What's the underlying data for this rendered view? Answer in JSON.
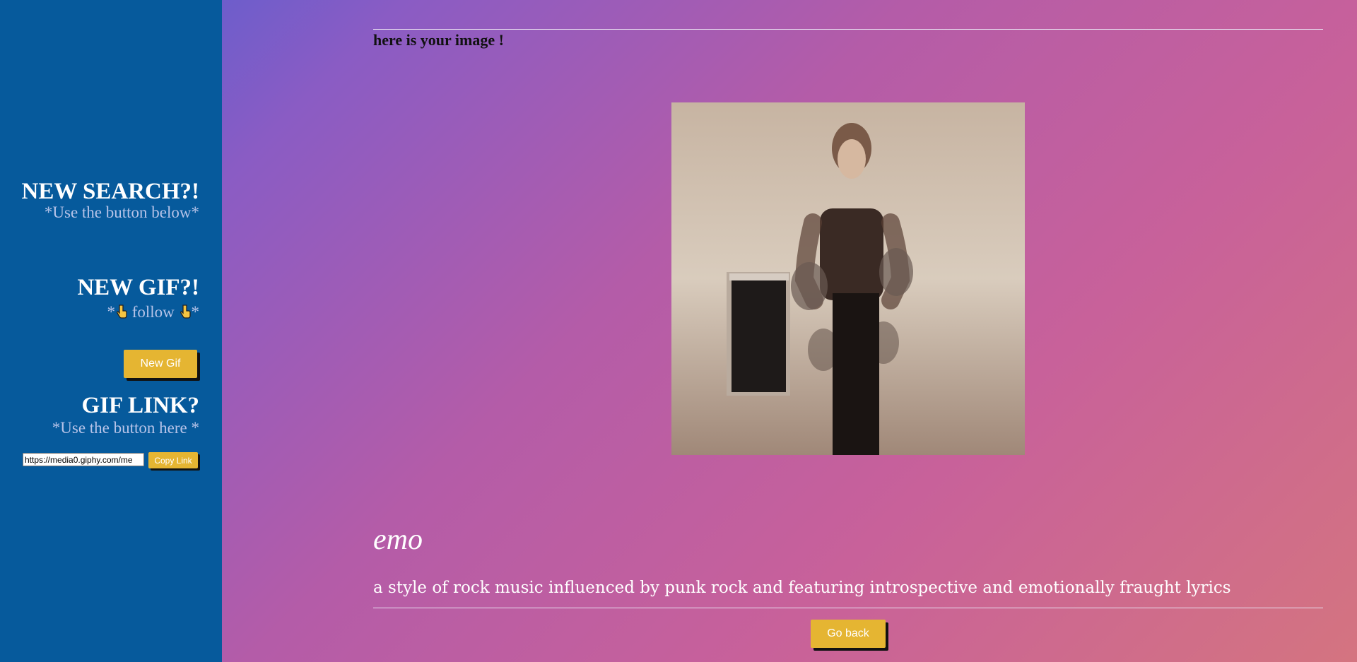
{
  "sidebar": {
    "search_heading": "NEW SEARCH?!",
    "search_sub": "*Use the button below*",
    "gif_heading": "NEW GIF?!",
    "gif_sub_pre": "*",
    "gif_sub_mid": " follow ",
    "gif_sub_post": "*",
    "new_gif_label": "New Gif",
    "link_heading": "GIF LINK?",
    "link_sub": "*Use the button here *",
    "link_value": "https://media0.giphy.com/me",
    "copy_label": "Copy Link"
  },
  "main": {
    "title": "here is your image !",
    "image_alt": "gif",
    "word": "emo",
    "definition": "a style of rock music influenced by punk rock and featuring introspective and emotionally fraught lyrics",
    "back_label": "Go back"
  },
  "icons": {
    "pointer": "backhand-index-pointing-down-icon"
  },
  "colors": {
    "sidebar_bg": "#065a9c",
    "button_bg": "#e5b532"
  }
}
